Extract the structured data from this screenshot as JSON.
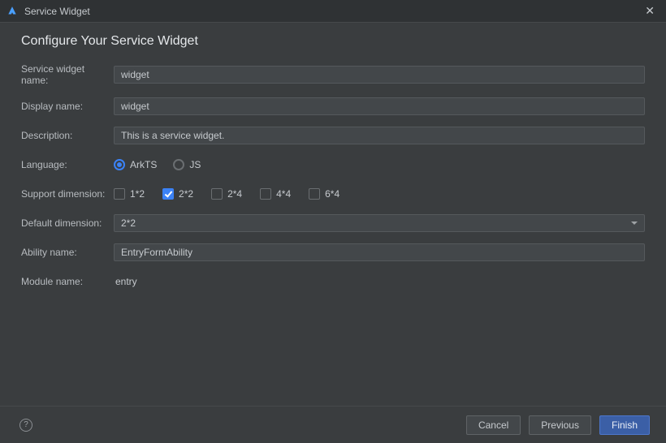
{
  "titlebar": {
    "title": "Service Widget"
  },
  "main": {
    "page_title": "Configure Your Service Widget",
    "labels": {
      "widget_name": "Service widget name:",
      "display_name": "Display name:",
      "description": "Description:",
      "language": "Language:",
      "support_dim": "Support dimension:",
      "default_dim": "Default dimension:",
      "ability_name": "Ability name:",
      "module_name": "Module name:"
    },
    "fields": {
      "widget_name": "widget",
      "display_name": "widget",
      "description": "This is a service widget.",
      "ability_name": "EntryFormAbility",
      "module_name": "entry"
    },
    "language": {
      "options": [
        {
          "label": "ArkTS",
          "value": "arkts",
          "selected": true
        },
        {
          "label": "JS",
          "value": "js",
          "selected": false
        }
      ]
    },
    "support_dimensions": {
      "options": [
        {
          "label": "1*2",
          "checked": false
        },
        {
          "label": "2*2",
          "checked": true
        },
        {
          "label": "2*4",
          "checked": false
        },
        {
          "label": "4*4",
          "checked": false
        },
        {
          "label": "6*4",
          "checked": false
        }
      ]
    },
    "default_dimension": {
      "value": "2*2"
    }
  },
  "footer": {
    "cancel": "Cancel",
    "previous": "Previous",
    "finish": "Finish"
  }
}
